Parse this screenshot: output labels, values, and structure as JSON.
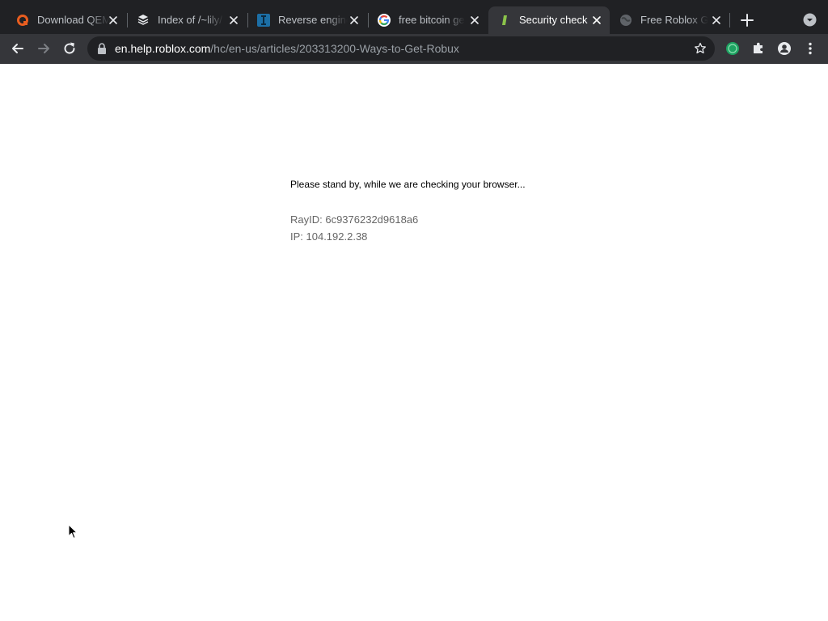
{
  "tabs": [
    {
      "title": "Download QEMU",
      "favicon": "qemu-icon",
      "active": false
    },
    {
      "title": "Index of /~lily/",
      "favicon": "directory-icon",
      "active": false
    },
    {
      "title": "Reverse engineering",
      "favicon": "i-letter-icon",
      "active": false
    },
    {
      "title": "free bitcoin generator",
      "favicon": "google-icon",
      "active": false
    },
    {
      "title": "Security check",
      "favicon": "leaf-icon",
      "active": true
    },
    {
      "title": "Free Roblox Generator",
      "favicon": "globe-icon",
      "active": false
    }
  ],
  "address_bar": {
    "host": "en.help.roblox.com",
    "path": "/hc/en-us/articles/203313200-Ways-to-Get-Robux"
  },
  "page": {
    "message": "Please stand by, while we are checking your browser...",
    "ray_id": "RayID: 6c9376232d9618a6",
    "ip": "IP: 104.192.2.38"
  },
  "toolbar_icons": [
    "back-icon",
    "forward-icon",
    "reload-icon",
    "lock-icon",
    "star-icon",
    "extension-badge-icon",
    "puzzle-icon",
    "profile-icon",
    "more-icon"
  ],
  "colors": {
    "tabstrip_bg": "#202124",
    "toolbar_bg": "#35363a",
    "omnibox_bg": "#202124",
    "ext_badge": "#1ea362"
  }
}
